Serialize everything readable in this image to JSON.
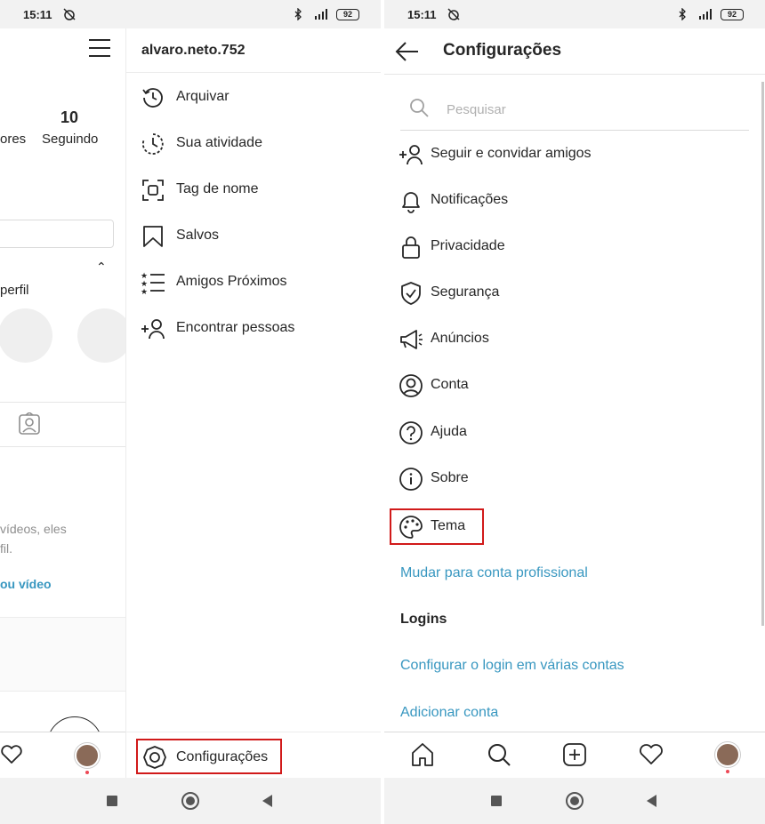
{
  "status_bar": {
    "time": "15:11",
    "battery": "92"
  },
  "left": {
    "profile": {
      "following_count": "10",
      "following_label": "Seguindo",
      "followers_label_partial": "ores",
      "discover_label_partial": "perfil",
      "empty_text_line1": "vídeos, eles",
      "empty_text_line2": "fil.",
      "empty_link_partial": "ou vídeo"
    },
    "drawer": {
      "username": "alvaro.neto.752",
      "items": [
        {
          "label": "Arquivar",
          "icon": "archive-history-icon"
        },
        {
          "label": "Sua atividade",
          "icon": "activity-clock-icon"
        },
        {
          "label": "Tag de nome",
          "icon": "nametag-icon"
        },
        {
          "label": "Salvos",
          "icon": "bookmark-icon"
        },
        {
          "label": "Amigos Próximos",
          "icon": "close-friends-icon"
        },
        {
          "label": "Encontrar pessoas",
          "icon": "add-person-icon"
        }
      ],
      "settings_label": "Configurações"
    }
  },
  "right": {
    "header": {
      "title": "Configurações"
    },
    "search": {
      "placeholder": "Pesquisar",
      "value": ""
    },
    "items": [
      {
        "label": "Seguir e convidar amigos",
        "icon": "add-person-icon"
      },
      {
        "label": "Notificações",
        "icon": "bell-icon"
      },
      {
        "label": "Privacidade",
        "icon": "lock-icon"
      },
      {
        "label": "Segurança",
        "icon": "shield-check-icon"
      },
      {
        "label": "Anúncios",
        "icon": "megaphone-icon"
      },
      {
        "label": "Conta",
        "icon": "account-circle-icon"
      },
      {
        "label": "Ajuda",
        "icon": "help-circle-icon"
      },
      {
        "label": "Sobre",
        "icon": "info-circle-icon"
      }
    ],
    "theme_label": "Tema",
    "switch_professional": "Mudar para conta profissional",
    "logins_heading": "Logins",
    "multi_login": "Configurar o login em várias contas",
    "add_account": "Adicionar conta"
  },
  "colors": {
    "link": "#3897c0",
    "highlight": "#d11a1a",
    "text": "#262626"
  }
}
